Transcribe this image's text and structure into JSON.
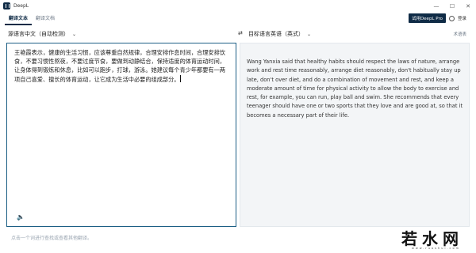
{
  "window": {
    "title": "DeepL",
    "controls": [
      "—",
      "☐",
      "✕"
    ]
  },
  "tabs": [
    {
      "label": "翻译文本",
      "active": true
    },
    {
      "label": "翻译文档",
      "active": false
    }
  ],
  "account": {
    "pro_label": "试用DeepL Pro",
    "login_label": "登录"
  },
  "langbar": {
    "source_lang": "源语言中文（自动检测）",
    "target_lang": "目标语言英语（英式）",
    "glossary_label": "术语表"
  },
  "source": {
    "text": "王艳霞表示，健康的生活习惯，应该尊重自然规律，合理安排作息时间，合理安排饮食，不要习惯性熬夜，不要过度节食，要做到动静结合，保持适度的体育运动时间，让身体得到锻炼和休息，比如可以跑步，打球，游泳。她建议每个青少年都要有一两项自己喜爱、擅长的体育运动，让它成为生活中必要的组成部分。"
  },
  "target": {
    "text": "Wang Yanxia said that healthy habits should respect the laws of nature, arrange work and rest time reasonably, arrange diet reasonably, don't habitually stay up late, don't over diet, and do a combination of movement and rest, and keep a moderate amount of time for physical activity to allow the body to exercise and rest, for example, you can run, play ball and swim. She recommends that every teenager should have one or two sports that they love and are good at, so that it becomes a necessary part of their life."
  },
  "dictionary_hint": "点击一个词进行查找或查看其他翻译。",
  "watermark": {
    "text": "若水网",
    "subtext": "www.ruoshui.com"
  },
  "colors": {
    "brand": "#0f2b46",
    "source_border": "#1d5f85",
    "target_bg": "#f3f5f7"
  }
}
